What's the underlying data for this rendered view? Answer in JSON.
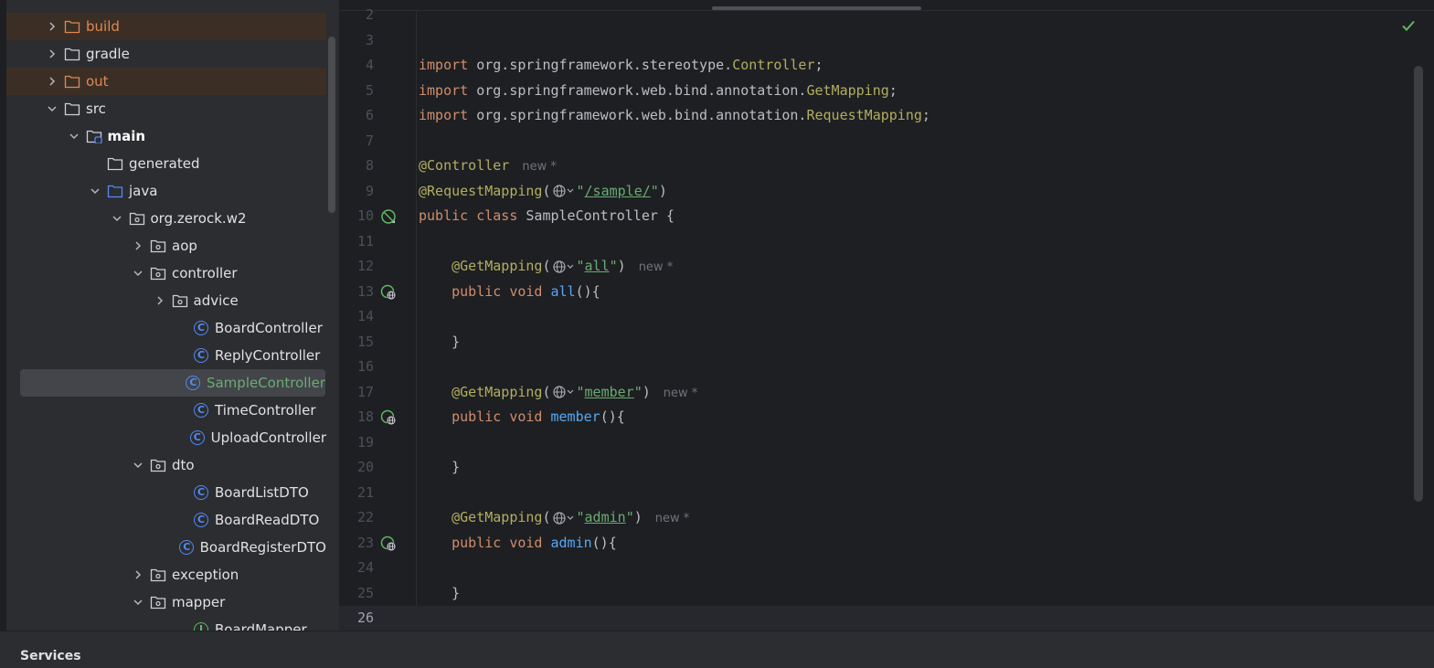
{
  "project_tree": [
    {
      "label": "build",
      "depth": 0,
      "chevron": "right",
      "icon": "folder-icon",
      "style": "excluded"
    },
    {
      "label": "gradle",
      "depth": 0,
      "chevron": "right",
      "icon": "folder-icon",
      "style": ""
    },
    {
      "label": "out",
      "depth": 0,
      "chevron": "right",
      "icon": "folder-icon",
      "style": "excluded"
    },
    {
      "label": "src",
      "depth": 0,
      "chevron": "down",
      "icon": "folder-icon",
      "style": ""
    },
    {
      "label": "main",
      "depth": 1,
      "chevron": "down",
      "icon": "source-root-folder-icon",
      "style": "bold"
    },
    {
      "label": "generated",
      "depth": 2,
      "chevron": "",
      "icon": "folder-icon",
      "style": ""
    },
    {
      "label": "java",
      "depth": 2,
      "chevron": "down",
      "icon": "source-folder-icon",
      "style": ""
    },
    {
      "label": "org.zerock.w2",
      "depth": 3,
      "chevron": "down",
      "icon": "package-icon",
      "style": ""
    },
    {
      "label": "aop",
      "depth": 4,
      "chevron": "right",
      "icon": "package-icon",
      "style": ""
    },
    {
      "label": "controller",
      "depth": 4,
      "chevron": "down",
      "icon": "package-icon",
      "style": ""
    },
    {
      "label": "advice",
      "depth": 5,
      "chevron": "right",
      "icon": "package-icon",
      "style": ""
    },
    {
      "label": "BoardController",
      "depth": 6,
      "chevron": "",
      "icon": "class-icon",
      "style": ""
    },
    {
      "label": "ReplyController",
      "depth": 6,
      "chevron": "",
      "icon": "class-icon",
      "style": ""
    },
    {
      "label": "SampleController",
      "depth": 6,
      "chevron": "",
      "icon": "class-icon",
      "style": "selected"
    },
    {
      "label": "TimeController",
      "depth": 6,
      "chevron": "",
      "icon": "class-icon",
      "style": ""
    },
    {
      "label": "UploadController",
      "depth": 6,
      "chevron": "",
      "icon": "class-icon",
      "style": ""
    },
    {
      "label": "dto",
      "depth": 4,
      "chevron": "down",
      "icon": "package-icon",
      "style": ""
    },
    {
      "label": "BoardListDTO",
      "depth": 6,
      "chevron": "",
      "icon": "class-icon",
      "style": ""
    },
    {
      "label": "BoardReadDTO",
      "depth": 6,
      "chevron": "",
      "icon": "class-icon",
      "style": ""
    },
    {
      "label": "BoardRegisterDTO",
      "depth": 6,
      "chevron": "",
      "icon": "class-icon",
      "style": ""
    },
    {
      "label": "exception",
      "depth": 4,
      "chevron": "right",
      "icon": "package-icon",
      "style": ""
    },
    {
      "label": "mapper",
      "depth": 4,
      "chevron": "down",
      "icon": "package-icon",
      "style": ""
    },
    {
      "label": "BoardMapper",
      "depth": 6,
      "chevron": "",
      "icon": "interface-icon",
      "style": ""
    }
  ],
  "editor": {
    "lines": [
      {
        "n": "2",
        "gutter": "",
        "tokens": []
      },
      {
        "n": "3",
        "gutter": "",
        "tokens": []
      },
      {
        "n": "4",
        "gutter": "",
        "tokens": [
          [
            "kw",
            "import "
          ],
          [
            "",
            "org.springframework.stereotype."
          ],
          [
            "ann",
            "Controller"
          ],
          [
            "",
            ";"
          ]
        ]
      },
      {
        "n": "5",
        "gutter": "",
        "tokens": [
          [
            "kw",
            "import "
          ],
          [
            "",
            "org.springframework.web.bind.annotation."
          ],
          [
            "ann",
            "GetMapping"
          ],
          [
            "",
            ";"
          ]
        ]
      },
      {
        "n": "6",
        "gutter": "",
        "tokens": [
          [
            "kw",
            "import "
          ],
          [
            "",
            "org.springframework.web.bind.annotation."
          ],
          [
            "ann",
            "RequestMapping"
          ],
          [
            "",
            ";"
          ]
        ]
      },
      {
        "n": "7",
        "gutter": "",
        "tokens": []
      },
      {
        "n": "8",
        "gutter": "",
        "tokens": [
          [
            "ann",
            "@Controller"
          ],
          [
            "hint",
            "new *"
          ]
        ]
      },
      {
        "n": "9",
        "gutter": "",
        "tokens": [
          [
            "ann",
            "@RequestMapping"
          ],
          [
            "",
            "("
          ],
          [
            "globe",
            ""
          ],
          [
            "str",
            "\""
          ],
          [
            "str-u",
            "/sample/"
          ],
          [
            "str",
            "\""
          ],
          [
            "",
            ")"
          ]
        ]
      },
      {
        "n": "10",
        "gutter": "bean-icon",
        "tokens": [
          [
            "kw",
            "public class "
          ],
          [
            "",
            "SampleController {"
          ]
        ]
      },
      {
        "n": "11",
        "gutter": "",
        "tokens": []
      },
      {
        "n": "12",
        "gutter": "",
        "tokens": [
          [
            "",
            "    "
          ],
          [
            "ann",
            "@GetMapping"
          ],
          [
            "",
            "("
          ],
          [
            "globe",
            ""
          ],
          [
            "str",
            "\""
          ],
          [
            "str-u",
            "all"
          ],
          [
            "str",
            "\""
          ],
          [
            "",
            ")"
          ],
          [
            "hint",
            "new *"
          ]
        ]
      },
      {
        "n": "13",
        "gutter": "endpoint-icon",
        "tokens": [
          [
            "",
            "    "
          ],
          [
            "kw",
            "public void "
          ],
          [
            "fn",
            "all"
          ],
          [
            "",
            "(){"
          ]
        ]
      },
      {
        "n": "14",
        "gutter": "",
        "tokens": []
      },
      {
        "n": "15",
        "gutter": "",
        "tokens": [
          [
            "",
            "    }"
          ]
        ]
      },
      {
        "n": "16",
        "gutter": "",
        "tokens": []
      },
      {
        "n": "17",
        "gutter": "",
        "tokens": [
          [
            "",
            "    "
          ],
          [
            "ann",
            "@GetMapping"
          ],
          [
            "",
            "("
          ],
          [
            "globe",
            ""
          ],
          [
            "str",
            "\""
          ],
          [
            "str-u",
            "member"
          ],
          [
            "str",
            "\""
          ],
          [
            "",
            ")"
          ],
          [
            "hint",
            "new *"
          ]
        ]
      },
      {
        "n": "18",
        "gutter": "endpoint-icon",
        "tokens": [
          [
            "",
            "    "
          ],
          [
            "kw",
            "public void "
          ],
          [
            "fn",
            "member"
          ],
          [
            "",
            "(){"
          ]
        ]
      },
      {
        "n": "19",
        "gutter": "",
        "tokens": []
      },
      {
        "n": "20",
        "gutter": "",
        "tokens": [
          [
            "",
            "    }"
          ]
        ]
      },
      {
        "n": "21",
        "gutter": "",
        "tokens": []
      },
      {
        "n": "22",
        "gutter": "",
        "tokens": [
          [
            "",
            "    "
          ],
          [
            "ann",
            "@GetMapping"
          ],
          [
            "",
            "("
          ],
          [
            "globe",
            ""
          ],
          [
            "str",
            "\""
          ],
          [
            "str-u",
            "admin"
          ],
          [
            "str",
            "\""
          ],
          [
            "",
            ")"
          ],
          [
            "hint",
            "new *"
          ]
        ]
      },
      {
        "n": "23",
        "gutter": "endpoint-icon",
        "tokens": [
          [
            "",
            "    "
          ],
          [
            "kw",
            "public void "
          ],
          [
            "fn",
            "admin"
          ],
          [
            "",
            "(){"
          ]
        ]
      },
      {
        "n": "24",
        "gutter": "",
        "tokens": []
      },
      {
        "n": "25",
        "gutter": "",
        "tokens": [
          [
            "",
            "    }"
          ]
        ]
      },
      {
        "n": "26",
        "gutter": "",
        "tokens": [],
        "current": true
      }
    ]
  },
  "bottom_bar": {
    "services_label": "Services"
  },
  "colors": {
    "accent": "#548af7",
    "excluded": "#e08855",
    "string": "#6aab73",
    "keyword": "#cf8e6d",
    "annotation": "#b3ae60"
  }
}
